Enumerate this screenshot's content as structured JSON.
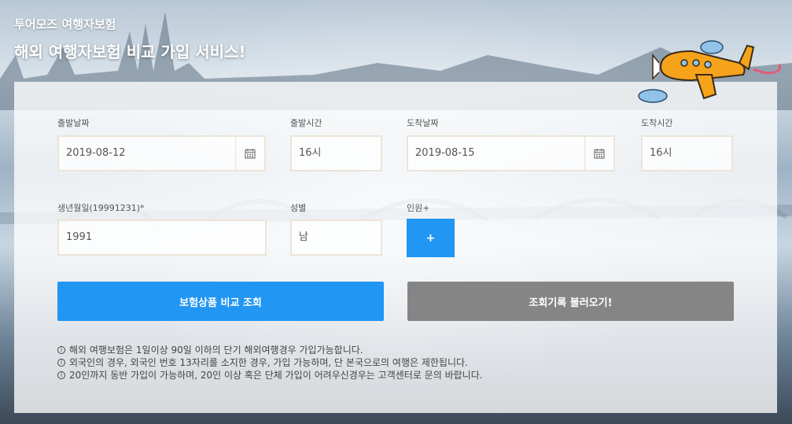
{
  "header": {
    "brand": "투어모즈 여행자보험",
    "headline": "해외 여행자보험 비교 가입 서비스!"
  },
  "form": {
    "departure_date": {
      "label": "출발날짜",
      "value": "2019-08-12",
      "icon": "calendar-icon"
    },
    "departure_time": {
      "label": "출발시간",
      "value": "16시"
    },
    "arrival_date": {
      "label": "도착날짜",
      "value": "2019-08-15",
      "icon": "calendar-icon"
    },
    "arrival_time": {
      "label": "도착시간",
      "value": "16시"
    },
    "birthdate": {
      "label": "생년월일(19991231)*",
      "value": "1991"
    },
    "gender": {
      "label": "성별",
      "value": "남"
    },
    "people": {
      "label": "인원+",
      "button": "+"
    }
  },
  "actions": {
    "compare": "보험상품 비교 조회",
    "load_history": "조회기록 불러오기!"
  },
  "notes": [
    "해외 여행보험은 1일이상 90일 이하의 단기 해외여행경우 가입가능합니다.",
    "외국인의 경우, 외국인 번호 13자리를 소지한 경우, 가입 가능하며, 단 본국으로의 여행은 제한됩니다.",
    "20인까지 동반 가입이 가능하며, 20인 이상 혹은 단체 가입이 어려우신경우는 고객센터로 문의 바랍니다."
  ],
  "colors": {
    "primary": "#2196f3",
    "secondary": "#858585",
    "field_border": "#ece4d6"
  }
}
